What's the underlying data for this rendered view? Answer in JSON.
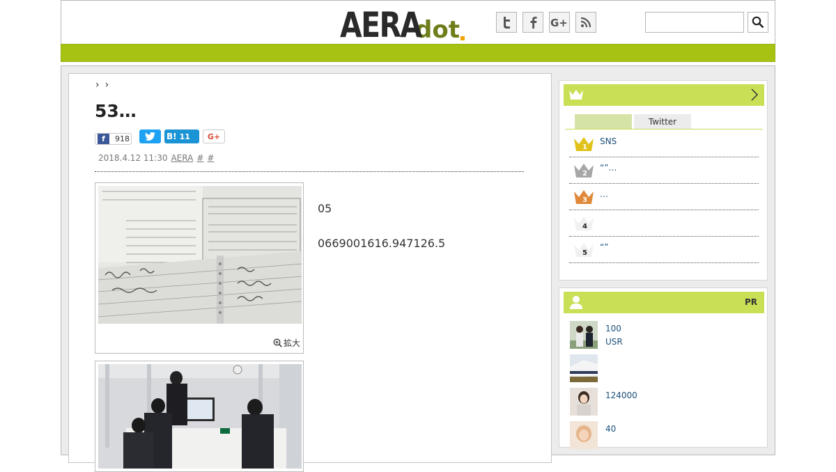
{
  "header": {
    "logo_main": "AERA",
    "logo_sub": "dot",
    "search_placeholder": ""
  },
  "breadcrumb": [
    "›",
    "›"
  ],
  "article": {
    "title": "53…",
    "share": {
      "facebook_count": "918",
      "hatena_label": "B!",
      "hatena_count": "11",
      "gplus_label": "G+"
    },
    "meta": {
      "datetime": "2018.4.12 11:30",
      "author": "AERA",
      "tag1": "#",
      "tag2": "#"
    },
    "zoom_label": "拡大",
    "paragraphs": [
      "",
      "05",
      "0669001616.947126.5",
      ""
    ]
  },
  "ranking": {
    "tabs": [
      "",
      "Twitter"
    ],
    "items": [
      {
        "rank": "1",
        "text": "SNS"
      },
      {
        "rank": "2",
        "text": "“”…"
      },
      {
        "rank": "3",
        "text": "…"
      },
      {
        "rank": "4",
        "text": ""
      },
      {
        "rank": "5",
        "text": "“”"
      }
    ]
  },
  "pr": {
    "label": "PR",
    "items": [
      {
        "text": "100\nUSR"
      },
      {
        "text": ""
      },
      {
        "text": "124000"
      },
      {
        "text": "40"
      }
    ]
  },
  "colors": {
    "accent": "#a8c214",
    "sidehead": "#c9df55",
    "link": "#1a4f7a"
  }
}
